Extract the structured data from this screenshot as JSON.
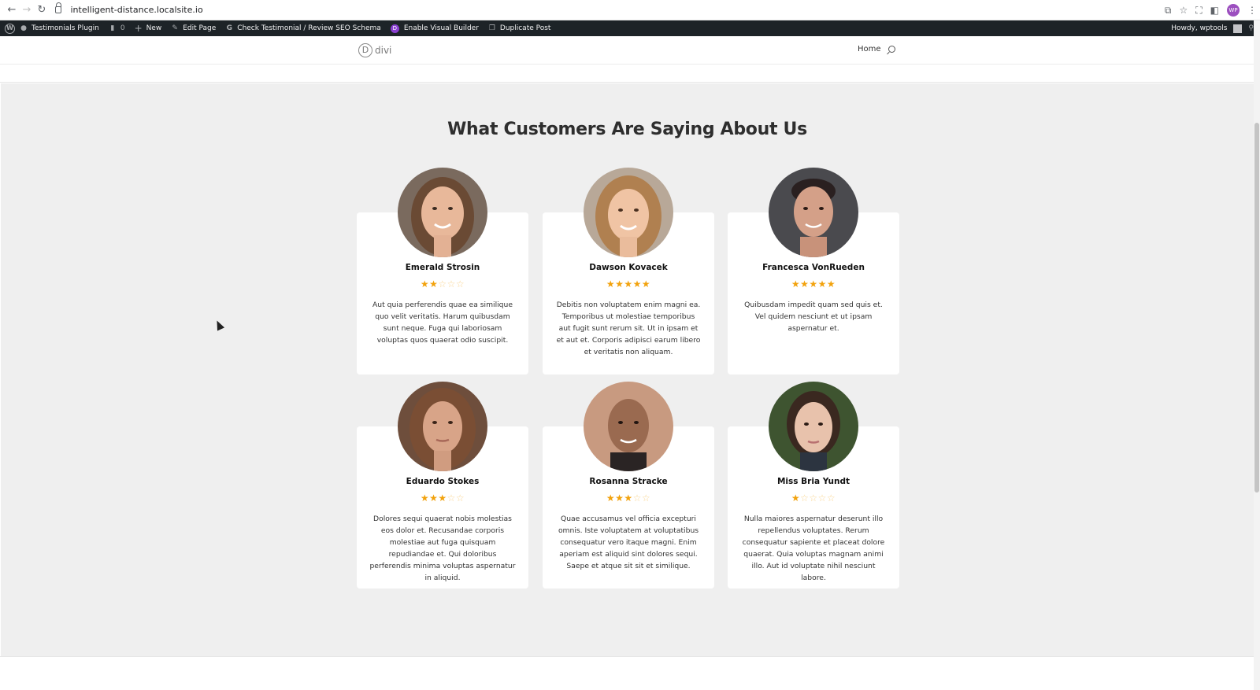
{
  "browser": {
    "url": "intelligent-distance.localsite.io",
    "profile_initials": "WP"
  },
  "admin_bar": {
    "items": [
      {
        "label": "Testimonials Plugin",
        "icon": "dashboard-icon"
      },
      {
        "label": "0",
        "icon": "comment-icon"
      },
      {
        "label": "New",
        "icon": "plus-icon"
      },
      {
        "label": "Edit Page",
        "icon": "pencil-icon"
      },
      {
        "label": "Check Testimonial / Review SEO Schema",
        "icon": "google-icon"
      },
      {
        "label": "Enable Visual Builder",
        "icon": "divi-icon"
      },
      {
        "label": "Duplicate Post",
        "icon": "duplicate-icon"
      }
    ],
    "greeting": "Howdy, wptools"
  },
  "site_header": {
    "logo_text": "divi",
    "logo_letter": "D",
    "menu": [
      "Home"
    ]
  },
  "section": {
    "title": "What Customers Are Saying About Us"
  },
  "testimonials": [
    {
      "name": "Emerald Strosin",
      "rating": 2,
      "text": "Aut quia perferendis quae ea similique quo velit veritatis. Harum quibusdam sunt neque. Fuga qui laboriosam voluptas quos quaerat odio suscipit."
    },
    {
      "name": "Dawson Kovacek",
      "rating": 5,
      "text": "Debitis non voluptatem enim magni ea. Temporibus ut molestiae temporibus aut fugit sunt rerum sit. Ut in ipsam et et aut et. Corporis adipisci earum libero et veritatis non aliquam."
    },
    {
      "name": "Francesca VonRueden",
      "rating": 5,
      "text": "Quibusdam impedit quam sed quis et. Vel quidem nesciunt et ut ipsam aspernatur et."
    },
    {
      "name": "Eduardo Stokes",
      "rating": 3,
      "text": "Dolores sequi quaerat nobis molestias eos dolor et. Recusandae corporis molestiae aut fuga quisquam repudiandae et. Qui doloribus perferendis minima voluptas aspernatur in aliquid."
    },
    {
      "name": "Rosanna Stracke",
      "rating": 3,
      "text": "Quae accusamus vel officia excepturi omnis. Iste voluptatem at voluptatibus consequatur vero itaque magni. Enim aperiam est aliquid sint dolores sequi. Saepe et atque sit sit et similique."
    },
    {
      "name": "Miss Bria Yundt",
      "rating": 1,
      "text": "Nulla maiores aspernatur deserunt illo repellendus voluptates. Rerum consequatur sapiente et placeat dolore quaerat. Quia voluptas magnam animi illo. Aut id voluptate nihil nesciunt labore."
    }
  ],
  "colors": {
    "star": "#f2a20c",
    "section_bg": "#efefef",
    "admin_bar": "#1d2327"
  }
}
